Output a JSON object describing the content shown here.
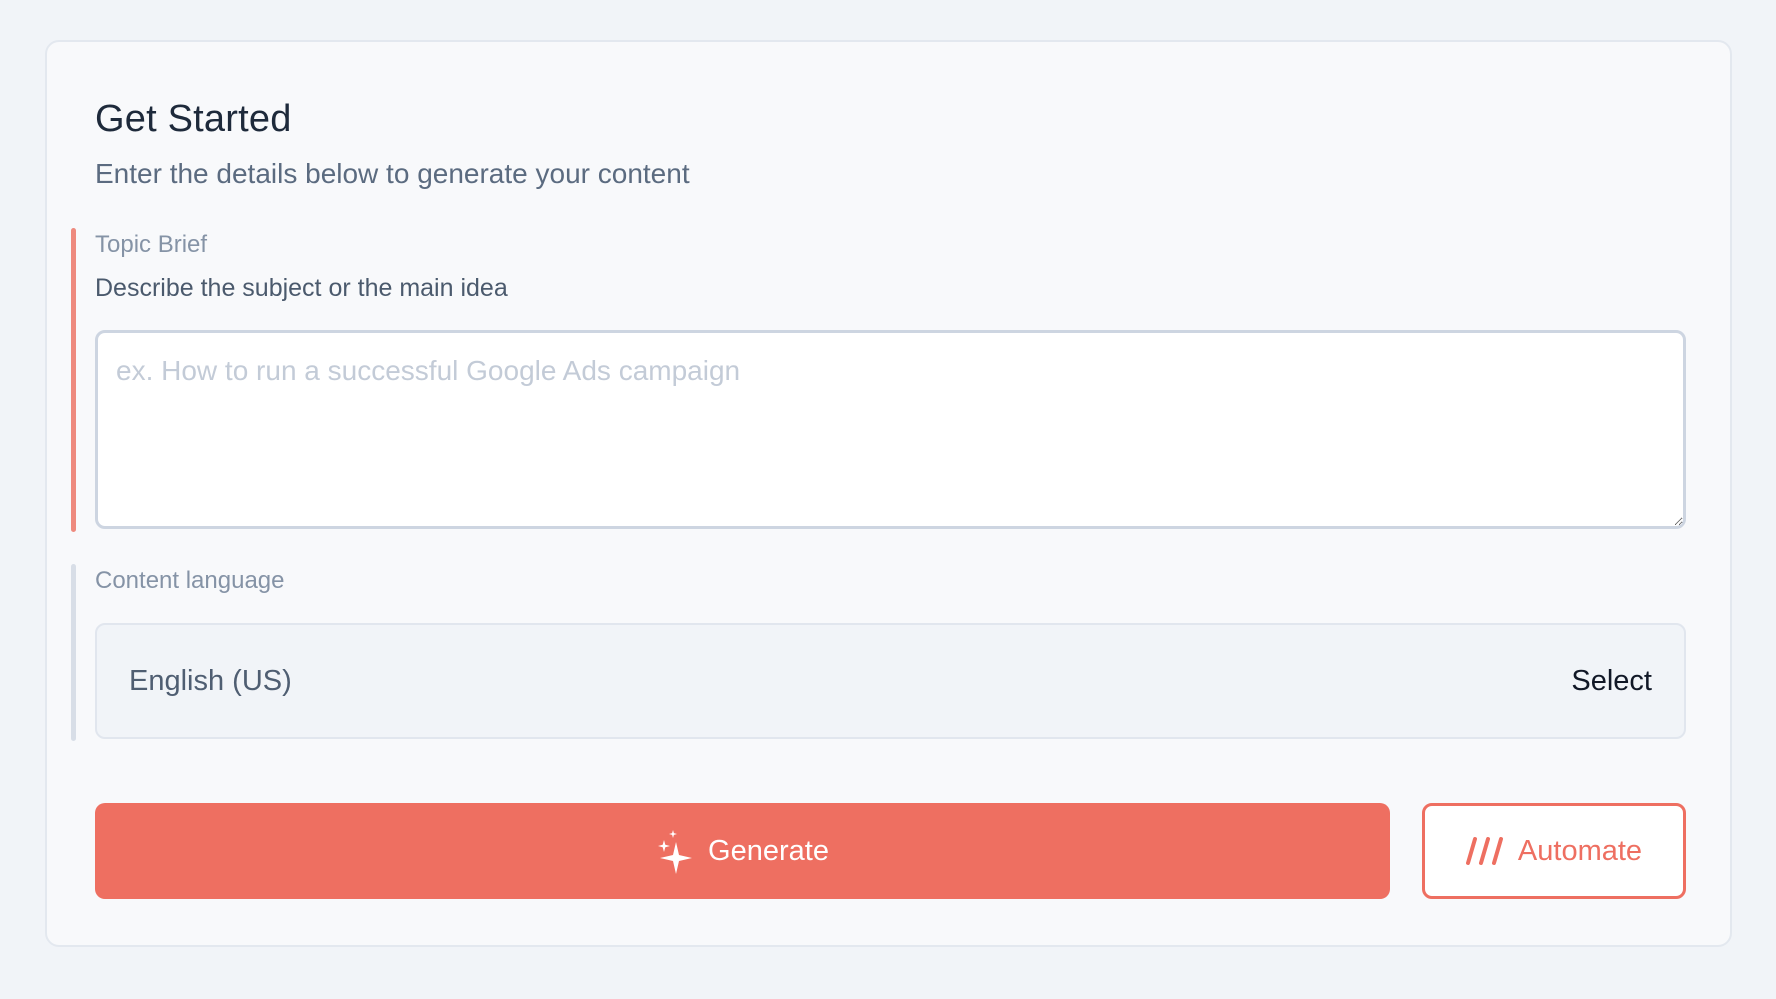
{
  "header": {
    "title": "Get Started",
    "subtitle": "Enter the details below to generate your content"
  },
  "topic": {
    "label": "Topic Brief",
    "hint": "Describe the subject or the main idea",
    "placeholder": "ex. How to run a successful Google Ads campaign",
    "value": ""
  },
  "language": {
    "label": "Content language",
    "value": "English (US)",
    "action": "Select"
  },
  "actions": {
    "generate_label": "Generate",
    "generate_icon": "sparkles-icon",
    "automate_label": "Automate",
    "automate_icon": "slashes-icon"
  },
  "colors": {
    "accent": "#ee6f61",
    "active_section": "#ee8a7e",
    "inactive_section": "#d8dee7"
  }
}
